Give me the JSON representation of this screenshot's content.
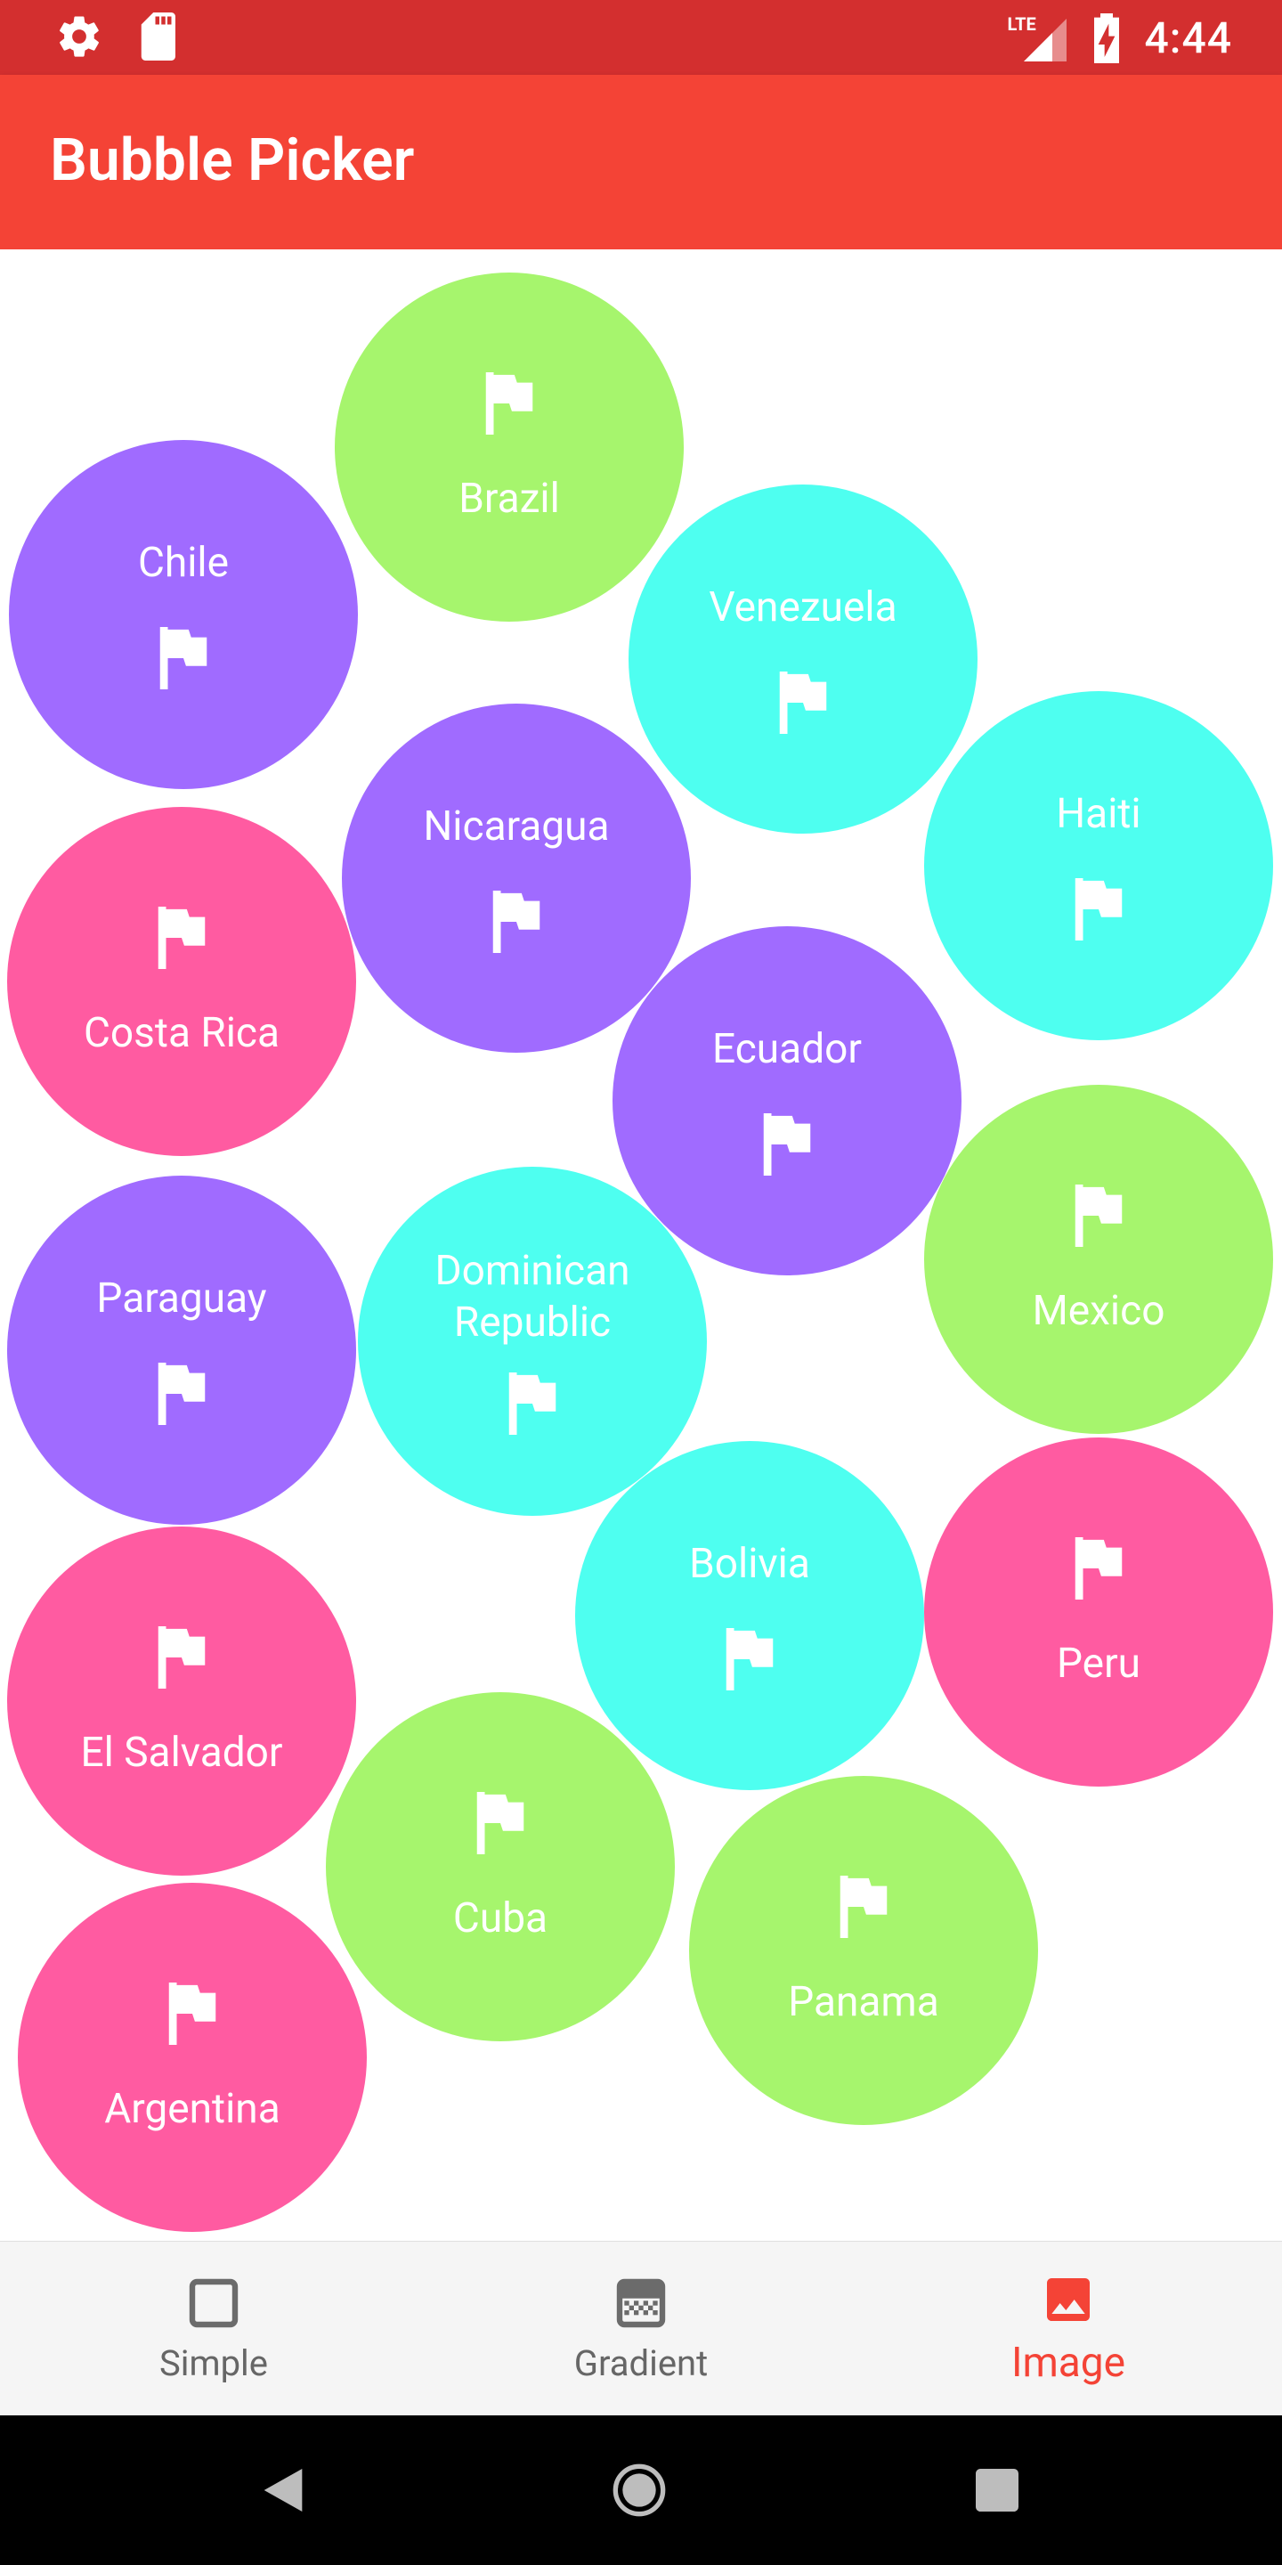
{
  "status_bar": {
    "network": "LTE",
    "time": "4:44",
    "icons": [
      "settings-icon",
      "sd-card-icon",
      "lte-signal-icon",
      "battery-charging-icon"
    ]
  },
  "app_bar": {
    "title": "Bubble Picker"
  },
  "colors": {
    "purple": "#a06bff",
    "green": "#a6f56d",
    "cyan": "#4efff0",
    "pink": "#ff5ba1",
    "status_bar": "#d32f2f",
    "app_bar": "#f44336",
    "active_nav": "#f44336"
  },
  "bubbles": [
    {
      "label": "Brazil",
      "color": "green",
      "flag_position": "top"
    },
    {
      "label": "Chile",
      "color": "purple",
      "flag_position": "bottom"
    },
    {
      "label": "Venezuela",
      "color": "cyan",
      "flag_position": "bottom"
    },
    {
      "label": "Nicaragua",
      "color": "purple",
      "flag_position": "bottom"
    },
    {
      "label": "Haiti",
      "color": "cyan",
      "flag_position": "bottom"
    },
    {
      "label": "Costa Rica",
      "color": "pink",
      "flag_position": "top"
    },
    {
      "label": "Ecuador",
      "color": "purple",
      "flag_position": "bottom"
    },
    {
      "label": "Mexico",
      "color": "green",
      "flag_position": "top"
    },
    {
      "label": "Paraguay",
      "color": "purple",
      "flag_position": "bottom"
    },
    {
      "label": "Dominican Republic",
      "color": "cyan",
      "flag_position": "bottom"
    },
    {
      "label": "Bolivia",
      "color": "cyan",
      "flag_position": "bottom"
    },
    {
      "label": "Peru",
      "color": "pink",
      "flag_position": "top"
    },
    {
      "label": "El Salvador",
      "color": "pink",
      "flag_position": "top"
    },
    {
      "label": "Cuba",
      "color": "green",
      "flag_position": "top"
    },
    {
      "label": "Panama",
      "color": "green",
      "flag_position": "top"
    },
    {
      "label": "Argentina",
      "color": "pink",
      "flag_position": "top"
    }
  ],
  "bottom_nav": {
    "items": [
      {
        "label": "Simple",
        "icon": "square-outline-icon",
        "active": false
      },
      {
        "label": "Gradient",
        "icon": "gradient-icon",
        "active": false
      },
      {
        "label": "Image",
        "icon": "image-icon",
        "active": true
      }
    ]
  },
  "system_nav": {
    "icons": [
      "back-icon",
      "home-icon",
      "recents-icon"
    ]
  }
}
